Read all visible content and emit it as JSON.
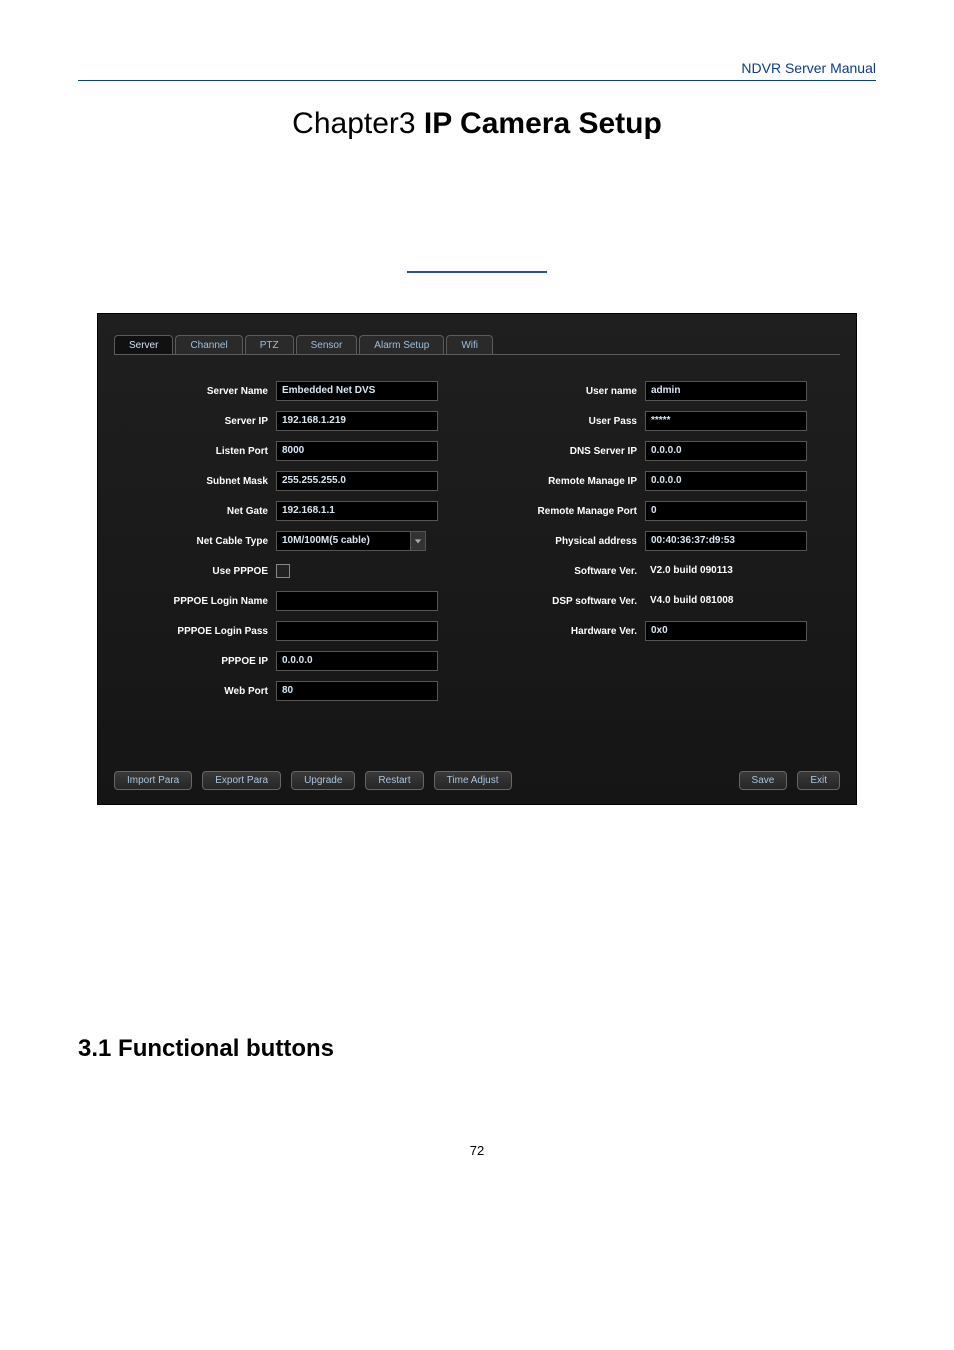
{
  "header": {
    "manual_title": "NDVR Server Manual"
  },
  "chapter": {
    "prefix": "Chapter3 ",
    "title": "IP Camera Setup"
  },
  "tabs": {
    "server": "Server",
    "channel": "Channel",
    "ptz": "PTZ",
    "sensor": "Sensor",
    "alarm_setup": "Alarm Setup",
    "wifi": "Wifi"
  },
  "left": {
    "server_name": {
      "label": "Server Name",
      "value": "Embedded Net DVS"
    },
    "server_ip": {
      "label": "Server IP",
      "value": "192.168.1.219"
    },
    "listen_port": {
      "label": "Listen Port",
      "value": "8000"
    },
    "subnet_mask": {
      "label": "Subnet Mask",
      "value": "255.255.255.0"
    },
    "net_gate": {
      "label": "Net Gate",
      "value": "192.168.1.1"
    },
    "net_cable_type": {
      "label": "Net Cable Type",
      "value": "10M/100M(5 cable)"
    },
    "use_pppoe": {
      "label": "Use PPPOE"
    },
    "pppoe_login_name": {
      "label": "PPPOE Login Name",
      "value": ""
    },
    "pppoe_login_pass": {
      "label": "PPPOE Login Pass",
      "value": ""
    },
    "pppoe_ip": {
      "label": "PPPOE IP",
      "value": "0.0.0.0"
    },
    "web_port": {
      "label": "Web Port",
      "value": "80"
    }
  },
  "right": {
    "user_name": {
      "label": "User name",
      "value": "admin"
    },
    "user_pass": {
      "label": "User Pass",
      "value": "*****"
    },
    "dns_server_ip": {
      "label": "DNS Server IP",
      "value": "0.0.0.0"
    },
    "remote_manage_ip": {
      "label": "Remote Manage IP",
      "value": "0.0.0.0"
    },
    "remote_manage_port": {
      "label": "Remote Manage Port",
      "value": "0"
    },
    "physical_address": {
      "label": "Physical address",
      "value": "00:40:36:37:d9:53"
    },
    "software_ver": {
      "label": "Software Ver.",
      "value": "V2.0 build 090113"
    },
    "dsp_software_ver": {
      "label": "DSP software Ver.",
      "value": "V4.0 build 081008"
    },
    "hardware_ver": {
      "label": "Hardware Ver.",
      "value": "0x0"
    }
  },
  "buttons": {
    "import_para": "Import Para",
    "export_para": "Export Para",
    "upgrade": "Upgrade",
    "restart": "Restart",
    "time_adjust": "Time Adjust",
    "save": "Save",
    "exit": "Exit"
  },
  "section": {
    "heading": "3.1 Functional buttons"
  },
  "page_number": "72"
}
